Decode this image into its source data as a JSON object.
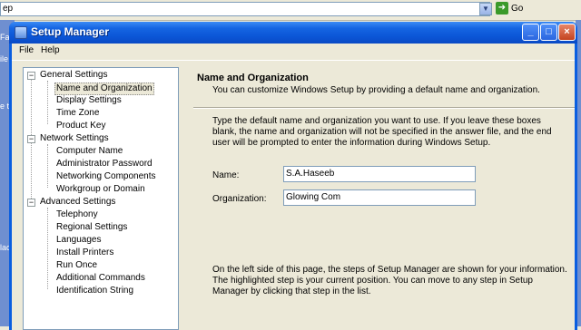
{
  "browser": {
    "address_text": "ep",
    "go_label": "Go",
    "side_fragments": [
      "Fas",
      "ile",
      "e to",
      "lac"
    ]
  },
  "window": {
    "title": "Setup Manager",
    "buttons": {
      "minimize": "_",
      "maximize": "□",
      "close": "×"
    }
  },
  "menu": {
    "file": "File",
    "help": "Help"
  },
  "tree": {
    "groups": [
      {
        "label": "General Settings",
        "expander": "−",
        "items": [
          "Name and Organization",
          "Display Settings",
          "Time Zone",
          "Product Key"
        ]
      },
      {
        "label": "Network Settings",
        "expander": "−",
        "items": [
          "Computer Name",
          "Administrator Password",
          "Networking Components",
          "Workgroup or Domain"
        ]
      },
      {
        "label": "Advanced Settings",
        "expander": "−",
        "items": [
          "Telephony",
          "Regional Settings",
          "Languages",
          "Install Printers",
          "Run Once",
          "Additional Commands",
          "Identification String"
        ]
      }
    ],
    "selected_item": "Name and Organization"
  },
  "page": {
    "title": "Name and Organization",
    "subtitle": "You can customize Windows Setup by providing a default name and organization.",
    "intro_lines": [
      "Type the default name and organization you want to use. If you leave these boxes",
      "blank, the name and organization will not be specified in the answer file, and the end",
      "user will be prompted to enter the information during Windows Setup."
    ],
    "name_label": "Name:",
    "name_value": "S.A.Haseeb",
    "org_label": "Organization:",
    "org_value": "Glowing Com",
    "footer_lines": [
      "On the left side of this page, the steps of Setup Manager are shown for your information.",
      "The highlighted step is your current position. You can move to any step in Setup",
      "Manager by clicking that step in the list."
    ]
  }
}
